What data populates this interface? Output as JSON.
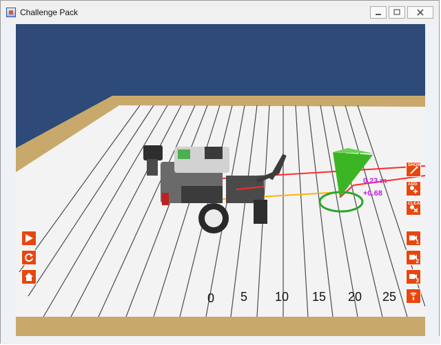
{
  "window": {
    "title": "Challenge Pack",
    "buttons": [
      "minimize",
      "maximize",
      "close"
    ]
  },
  "left_controls": [
    {
      "name": "play",
      "icon": "play-icon"
    },
    {
      "name": "reset",
      "icon": "reset-icon"
    },
    {
      "name": "home",
      "icon": "home-icon"
    }
  ],
  "right_controls": [
    {
      "label": "SHOW",
      "icon": "pen-icon"
    },
    {
      "label": "ADD",
      "icon": "add-marker-icon"
    },
    {
      "label": "CLEAR",
      "icon": "clear-marker-icon"
    },
    {
      "label": "1",
      "icon": "camera-1-icon"
    },
    {
      "label": "2",
      "icon": "camera-2-icon"
    },
    {
      "label": "3",
      "icon": "camera-3-icon"
    },
    {
      "label": "",
      "icon": "signal-icon"
    }
  ],
  "ruler": {
    "labels": [
      "0",
      "5",
      "10",
      "15",
      "20",
      "25"
    ]
  },
  "measurements": {
    "distance": "0.23 m",
    "offset": "+0.68"
  },
  "colors": {
    "control_orange": "#e9460e",
    "ceiling_blue": "#2d4a78",
    "wood": "#c8a96b",
    "marker_green": "#3cb524",
    "distance_magenta": "#c21ee0",
    "red_line": "#ff2a2a",
    "yellow_line": "#ffb200"
  }
}
